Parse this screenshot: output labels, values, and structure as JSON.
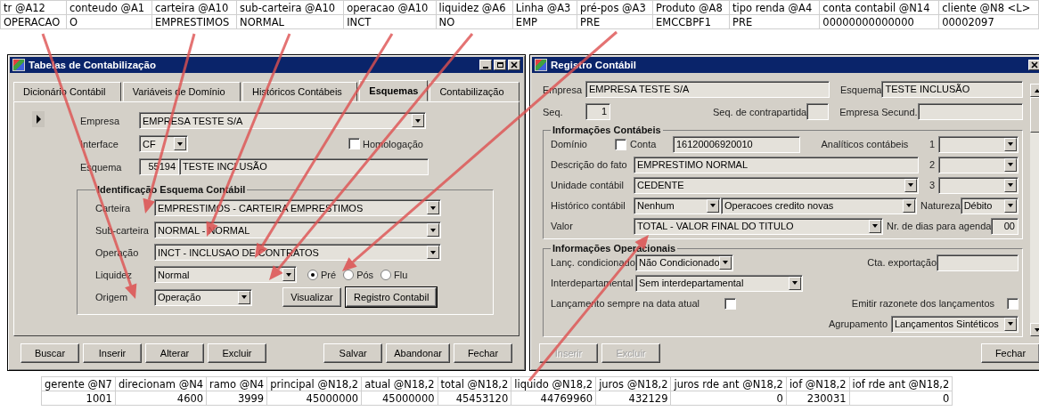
{
  "sheet_top": {
    "columns": [
      {
        "header": "tr @A12",
        "value": "OPERACAO"
      },
      {
        "header": "conteudo @A1",
        "value": "O"
      },
      {
        "header": "carteira @A10",
        "value": "EMPRESTIMOS"
      },
      {
        "header": "sub-carteira @A10",
        "value": "NORMAL"
      },
      {
        "header": "operacao @A10",
        "value": "INCT"
      },
      {
        "header": "liquidez @A6",
        "value": "NO"
      },
      {
        "header": "Linha @A3",
        "value": "EMP"
      },
      {
        "header": "pré-pos @A3",
        "value": "PRE"
      },
      {
        "header": "Produto @A8",
        "value": "EMCCBPF1"
      },
      {
        "header": "tipo renda @A4",
        "value": "PRE"
      },
      {
        "header": "conta contabil @N14",
        "value": "00000000000000"
      },
      {
        "header": "cliente @N8 <L>",
        "value": "00002097"
      }
    ]
  },
  "window_left": {
    "title": "Tabelas de Contabilização",
    "tabs": [
      {
        "label": "Dicionário Contábil",
        "selected": false
      },
      {
        "label": "Variáveis de Domínio",
        "selected": false
      },
      {
        "label": "Históricos Contábeis",
        "selected": false
      },
      {
        "label": "Esquemas",
        "selected": true
      },
      {
        "label": "Contabilização",
        "selected": false
      }
    ],
    "empresa": {
      "label": "Empresa",
      "value": "EMPRESA TESTE S/A"
    },
    "interface": {
      "label": "Interface",
      "value": "CF"
    },
    "homologacao": {
      "label": "Homologação",
      "checked": false
    },
    "esquema": {
      "label": "Esquema",
      "code": "55194",
      "value": "TESTE INCLUSÃO"
    },
    "group": {
      "title": "Identificação Esquema Contábil",
      "selects": [
        {
          "label": "Carteira",
          "value": "EMPRESTIMOS - CARTEIRA EMPRESTIMOS"
        },
        {
          "label": "Sub-carteira",
          "value": "NORMAL - NORMAL"
        },
        {
          "label": "Operação",
          "value": "INCT - INCLUSAO DE CONTRATOS"
        }
      ],
      "liquidez": {
        "label": "Liquidez",
        "value": "Normal"
      },
      "rate_options": [
        {
          "label": "Pré",
          "selected": true
        },
        {
          "label": "Pós",
          "selected": false
        },
        {
          "label": "Flu",
          "selected": false
        }
      ],
      "origem": {
        "label": "Origem",
        "value": "Operação"
      },
      "buttons": [
        {
          "label": "Visualizar",
          "default": false
        },
        {
          "label": "Registro Contabil",
          "default": true
        }
      ]
    },
    "buttons_left": [
      "Buscar",
      "Inserir",
      "Alterar",
      "Excluir"
    ],
    "buttons_right": [
      "Salvar",
      "Abandonar",
      "Fechar"
    ]
  },
  "window_right": {
    "title": "Registro Contábil",
    "empresa": {
      "label": "Empresa",
      "value": "EMPRESA TESTE S/A"
    },
    "esquema": {
      "label": "Esquema",
      "value": "TESTE INCLUSÃO"
    },
    "seq": {
      "label": "Seq.",
      "value": "1"
    },
    "contrapartida": {
      "label": "Seq. de contrapartida"
    },
    "empresa_secund": {
      "label": "Empresa Secund."
    },
    "contabeis": {
      "title": "Informações Contábeis",
      "dominio": {
        "label": "Domínio",
        "checked": false
      },
      "conta": {
        "label": "Conta",
        "value": "16120006920010"
      },
      "analiticos": {
        "label": "Analíticos contábeis",
        "slots": [
          "1",
          "2",
          "3"
        ]
      },
      "descricao": {
        "label": "Descrição do fato",
        "value": "EMPRESTIMO NORMAL"
      },
      "unidade": {
        "label": "Unidade contábil",
        "value": "CEDENTE"
      },
      "historico": {
        "label": "Histórico contábil",
        "value": "Nenhum",
        "detail": "Operacoes credito novas"
      },
      "natureza": {
        "label": "Natureza",
        "value": "Débito"
      },
      "valor": {
        "label": "Valor",
        "value": "TOTAL - VALOR FINAL DO TITULO"
      },
      "dias": {
        "label": "Nr. de dias para agenda",
        "value": "00"
      }
    },
    "operacionais": {
      "title": "Informações Operacionais",
      "condicionado": {
        "label": "Lanç. condicionado",
        "value": "Não Condicionado"
      },
      "exportacao": {
        "label": "Cta. exportação"
      },
      "interdepartamental": {
        "label": "Interdepartamental",
        "value": "Sem interdepartamental"
      },
      "data_atual": {
        "label": "Lançamento sempre na data atual",
        "checked": false
      },
      "razonete": {
        "label": "Emitir razonete dos lançamentos",
        "checked": false
      },
      "agrupamento": {
        "label": "Agrupamento",
        "value": "Lançamentos Sintéticos"
      }
    },
    "buttons": [
      {
        "label": "Inserir",
        "disabled": true
      },
      {
        "label": "Excluir",
        "disabled": true
      },
      {
        "label": "Fechar",
        "disabled": false
      }
    ]
  },
  "sheet_bottom": {
    "columns": [
      {
        "header": "gerente @N7",
        "value": "1001"
      },
      {
        "header": "direcionam @N4",
        "value": "4600"
      },
      {
        "header": "ramo @N4",
        "value": "3999"
      },
      {
        "header": "principal @N18,2",
        "value": "45000000"
      },
      {
        "header": "atual @N18,2",
        "value": "45000000"
      },
      {
        "header": "total @N18,2",
        "value": "45453120"
      },
      {
        "header": "liquido @N18,2",
        "value": "44769960"
      },
      {
        "header": "juros @N18,2",
        "value": "432129"
      },
      {
        "header": "juros rde ant @N18,2",
        "value": "0"
      },
      {
        "header": "iof @N18,2",
        "value": "230031"
      },
      {
        "header": "iof rde ant @N18,2",
        "value": "0"
      }
    ]
  }
}
